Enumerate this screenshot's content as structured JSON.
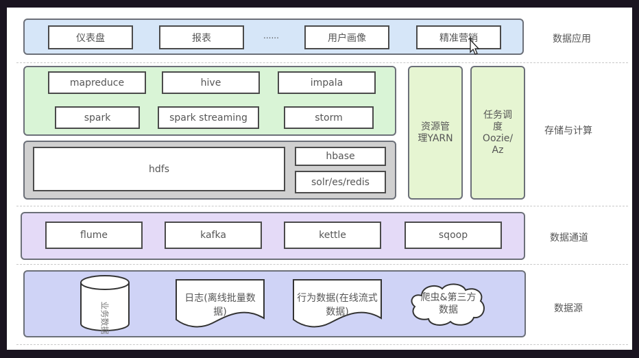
{
  "layers": {
    "app": {
      "label": "数据应用",
      "items": [
        "仪表盘",
        "报表",
        "......",
        "用户画像",
        "精准营销"
      ],
      "color": "#d6e6f8"
    },
    "compute": {
      "label": "存储与计算",
      "compute_items": [
        "mapreduce",
        "hive",
        "impala",
        "spark",
        "spark streaming",
        "storm"
      ],
      "storage_items": [
        "hdfs",
        "hbase",
        "solr/es/redis"
      ],
      "resource": "资源管理YARN",
      "resource_lines": [
        "资源管",
        "理YARN"
      ],
      "scheduler_lines": [
        "任务调",
        "度",
        "Oozie/",
        "Az"
      ],
      "compute_color": "#d9f4d6",
      "storage_color": "#d0d0d0"
    },
    "channel": {
      "label": "数据通道",
      "items": [
        "flume",
        "kafka",
        "kettle",
        "sqoop"
      ],
      "color": "#e4daf7"
    },
    "source": {
      "label": "数据源",
      "items": [
        "业务数据",
        "日志(离线批量数据)",
        "行为数据(在线流式数据)",
        "爬虫&第三方数据"
      ],
      "log_lines": [
        "日志(离线批量数",
        "据)"
      ],
      "behavior_lines": [
        "行为数据(在线流式",
        "数据)"
      ],
      "crawler_lines": [
        "爬虫&第三方",
        "数据"
      ],
      "db_lines": [
        "业务数据"
      ],
      "color": "#cfd3f6"
    }
  }
}
